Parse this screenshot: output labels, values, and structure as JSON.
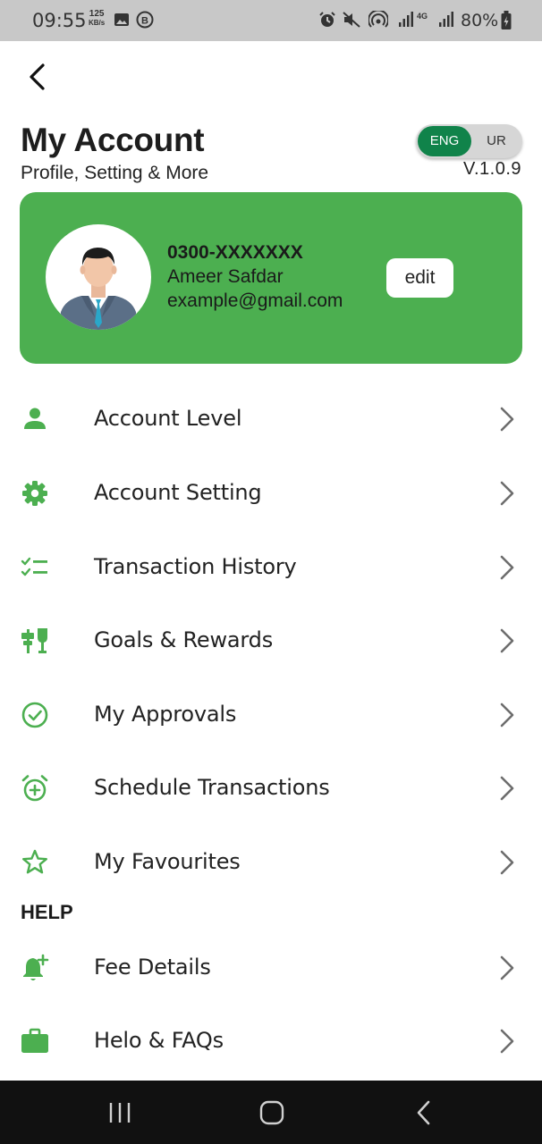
{
  "status_bar": {
    "time": "09:55",
    "speed_value": "125",
    "speed_unit": "KB/s",
    "network_label": "4G",
    "battery": "80%"
  },
  "header": {
    "title": "My Account",
    "subtitle": "Profile, Setting & More",
    "version": "V.1.0.9",
    "lang_active": "ENG",
    "lang_other": "UR"
  },
  "profile": {
    "phone": "0300-XXXXXXX",
    "name": "Ameer Safdar",
    "email": "example@gmail.com",
    "edit_label": "edit"
  },
  "menu": {
    "items": [
      {
        "label": "Account Level",
        "icon": "person-icon"
      },
      {
        "label": "Account Setting",
        "icon": "gear-icon"
      },
      {
        "label": "Transaction History",
        "icon": "checklist-icon"
      },
      {
        "label": "Goals & Rewards",
        "icon": "goals-rewards-icon"
      },
      {
        "label": "My Approvals",
        "icon": "check-circle-icon"
      },
      {
        "label": "Schedule Transactions",
        "icon": "alarm-add-icon"
      },
      {
        "label": "My Favourites",
        "icon": "star-icon"
      }
    ]
  },
  "help": {
    "title": "HELP",
    "items": [
      {
        "label": "Fee Details",
        "icon": "bell-plus-icon"
      },
      {
        "label": "Helo & FAQs",
        "icon": "briefcase-icon"
      }
    ]
  },
  "colors": {
    "accent": "#4caf50",
    "toggle_active": "#10834a",
    "chevron": "#6d6d6d",
    "status_bar": "#c8c8c8",
    "nav_bar": "#111111"
  }
}
